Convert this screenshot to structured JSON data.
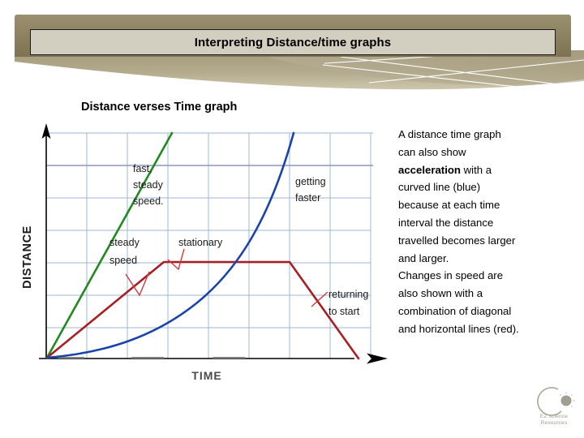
{
  "header": {
    "title": "Interpreting Distance/time graphs",
    "bar_color": "#8e8463",
    "box_color": "#d2cec0"
  },
  "subtitle": "Distance verses Time graph",
  "body_text": {
    "line_1": "A distance time graph",
    "line_2": "can also show",
    "line_3_bold": "acceleration",
    "line_3_rest": " with a",
    "line_4": "curved line (blue)",
    "line_5": "because at each time",
    "line_6": "interval the distance",
    "line_7": "travelled becomes larger",
    "line_8": "and larger.",
    "line_9": "Changes in speed are",
    "line_10": "also shown with a",
    "line_11": "combination of diagonal",
    "line_12": "and horizontal lines (red)."
  },
  "logo": {
    "line_1": "EZ science",
    "line_2": "Resources"
  },
  "chart_data": {
    "type": "line",
    "title": "Distance verses Time graph",
    "xlabel": "TIME",
    "ylabel": "DISTANCE",
    "xlim": [
      0,
      8
    ],
    "ylim": [
      0,
      7
    ],
    "grid": true,
    "grid_color": "#9bb7d4",
    "axis_color": "#000000",
    "legend_position": "inline-annotations",
    "tick_labels_shown": false,
    "series": [
      {
        "name": "fast, steady speed",
        "color": "#1f8a1f",
        "description": "straight steep line from origin",
        "x": [
          0,
          3.1
        ],
        "y": [
          0,
          7
        ]
      },
      {
        "name": "steady speed then stationary then returning to start",
        "color": "#a81f22",
        "description": "diagonal rise, horizontal plateau, diagonal fall back to zero",
        "x": [
          0,
          2.9,
          6.0,
          8.0
        ],
        "y": [
          0,
          3.0,
          3.0,
          0
        ]
      },
      {
        "name": "getting faster",
        "color": "#1b44a8",
        "description": "upward curving accelerating line",
        "x": [
          0,
          1,
          2,
          3,
          4,
          5,
          6,
          6.6
        ],
        "y": [
          0,
          0.16,
          0.64,
          1.44,
          2.56,
          4.0,
          5.76,
          6.9
        ]
      }
    ],
    "annotations": [
      {
        "id": "fast-steady-speed",
        "text": "fast,\nsteady\nspeed.",
        "x": 3.2,
        "y": 6.1,
        "series": "fast, steady speed"
      },
      {
        "id": "getting-faster",
        "text": "getting\nfaster",
        "x": 6.7,
        "y": 6.0,
        "series": "getting faster"
      },
      {
        "id": "steady-speed",
        "text": "steady\nspeed",
        "x": 2.2,
        "y": 3.9,
        "series": "steady speed"
      },
      {
        "id": "stationary",
        "text": "stationary",
        "x": 3.9,
        "y": 3.9,
        "series": "stationary"
      },
      {
        "id": "returning-to-start",
        "text": "returning\nto start",
        "x": 7.2,
        "y": 1.9,
        "series": "returning to start"
      }
    ],
    "annotation_labels": {
      "fast_1": "fast,",
      "fast_2": "steady",
      "fast_3": "speed.",
      "getting_1": "getting",
      "getting_2": "faster",
      "steady_1": "steady",
      "steady_2": "speed",
      "stationary": "stationary",
      "returning_1": "returning",
      "returning_2": "to start"
    }
  }
}
